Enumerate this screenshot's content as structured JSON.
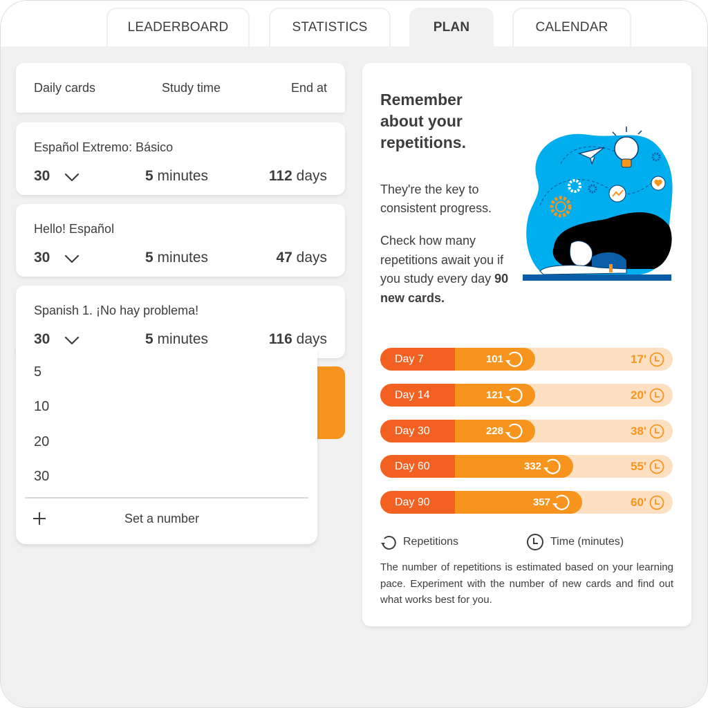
{
  "tabs": [
    {
      "label": "LEADERBOARD",
      "active": false
    },
    {
      "label": "STATISTICS",
      "active": false
    },
    {
      "label": "PLAN",
      "active": true
    },
    {
      "label": "CALENDAR",
      "active": false
    }
  ],
  "plan_header": {
    "daily_cards": "Daily cards",
    "study_time": "Study time",
    "end_at": "End at"
  },
  "courses": [
    {
      "title": "Español Extremo: Básico",
      "daily_cards": "30",
      "time_value": "5",
      "time_unit": "minutes",
      "end_value": "112",
      "end_unit": "days"
    },
    {
      "title": "Hello! Español",
      "daily_cards": "30",
      "time_value": "5",
      "time_unit": "minutes",
      "end_value": "47",
      "end_unit": "days"
    },
    {
      "title": "Spanish 1. ¡No hay problema!",
      "daily_cards": "30",
      "time_value": "5",
      "time_unit": "minutes",
      "end_value": "116",
      "end_unit": "days"
    }
  ],
  "dropdown": {
    "options": [
      "5",
      "10",
      "20",
      "30"
    ],
    "custom_label": "Set a number",
    "custom_icon": "plus-icon"
  },
  "info": {
    "title": "Remember about your repetitions.",
    "paragraph1": "They're the key to consistent progress.",
    "paragraph2_prefix": "Check how many repetitions await you if you study every day ",
    "paragraph2_bold": "90 new cards.",
    "illustration": "person-sleeping-on-desk-with-ideas-illustration",
    "rows": [
      {
        "day": "Day 7",
        "repetitions": "101",
        "minutes": "17'",
        "rep_fraction": 0.53
      },
      {
        "day": "Day 14",
        "repetitions": "121",
        "minutes": "20'",
        "rep_fraction": 0.53
      },
      {
        "day": "Day 30",
        "repetitions": "228",
        "minutes": "38'",
        "rep_fraction": 0.53
      },
      {
        "day": "Day 60",
        "repetitions": "332",
        "minutes": "55'",
        "rep_fraction": 0.66
      },
      {
        "day": "Day 90",
        "repetitions": "357",
        "minutes": "60'",
        "rep_fraction": 0.69
      }
    ],
    "legend": {
      "repetitions": "Repetitions",
      "time": "Time (minutes)"
    },
    "note": "The number of repetitions is estimated based on your learning pace. Experiment with the number of new cards and find out what works best for you."
  },
  "colors": {
    "accent_orange": "#f7941e",
    "accent_red_orange": "#f26122",
    "bar_track": "#fde0c2",
    "text": "#3d3d3d",
    "background": "#f1f1f1",
    "illustration_blue": "#00aeef"
  }
}
